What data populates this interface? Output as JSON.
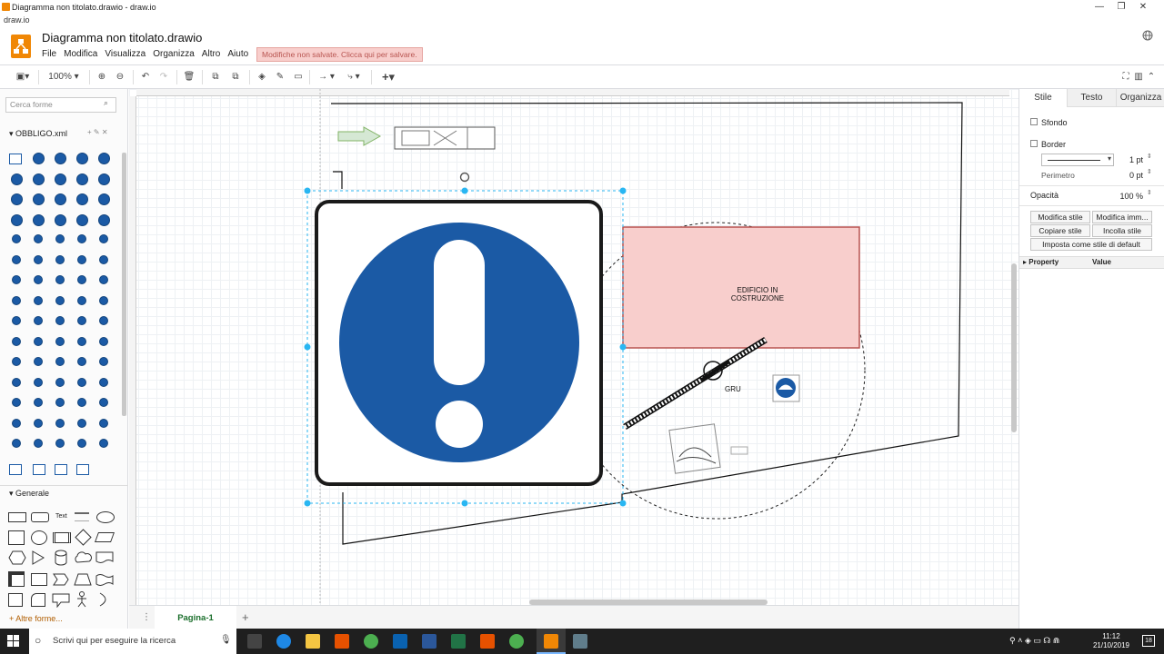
{
  "window": {
    "title": "Diagramma non titolato.drawio - draw.io",
    "subtitle": "draw.io",
    "minimize": "—",
    "maximize": "❐",
    "close": "✕"
  },
  "header": {
    "doc_title": "Diagramma non titolato.drawio",
    "menu": [
      "File",
      "Modifica",
      "Visualizza",
      "Organizza",
      "Altro",
      "Aiuto"
    ],
    "unsaved_notice": "Modifiche non salvate. Clicca qui per salvare."
  },
  "toolbar": {
    "zoom": "100%"
  },
  "sidebar": {
    "search_placeholder": "Cerca forme",
    "library_name": "OBBLIGO.xml",
    "general_label": "Generale",
    "text_shape_label": "Text",
    "more_shapes": "Altre forme..."
  },
  "canvas": {
    "building_label": "EDIFICIO IN\nCOSTRUZIONE",
    "crane_label": "GRU",
    "colors": {
      "building_fill": "#f8cecc",
      "building_stroke": "#b85450",
      "sign_blue": "#1b5aa5",
      "selection": "#29b6f2"
    }
  },
  "pages": {
    "current": "Pagina-1"
  },
  "format_panel": {
    "tabs": [
      "Stile",
      "Testo",
      "Organizza"
    ],
    "active_tab": "Stile",
    "background_label": "Sfondo",
    "border_label": "Border",
    "border_width": "1 pt",
    "perimeter_label": "Perimetro",
    "perimeter_value": "0 pt",
    "opacity_label": "Opacità",
    "opacity_value": "100 %",
    "btn_edit_style": "Modifica stile",
    "btn_edit_image": "Modifica imm...",
    "btn_copy_style": "Copiare stile",
    "btn_paste_style": "Incolla stile",
    "btn_default_style": "Imposta come stile di default",
    "prop_header": "Property",
    "value_header": "Value"
  },
  "taskbar": {
    "search_placeholder": "Scrivi qui per eseguire la ricerca",
    "time": "11:12",
    "date": "21/10/2019",
    "notifications": "18"
  }
}
